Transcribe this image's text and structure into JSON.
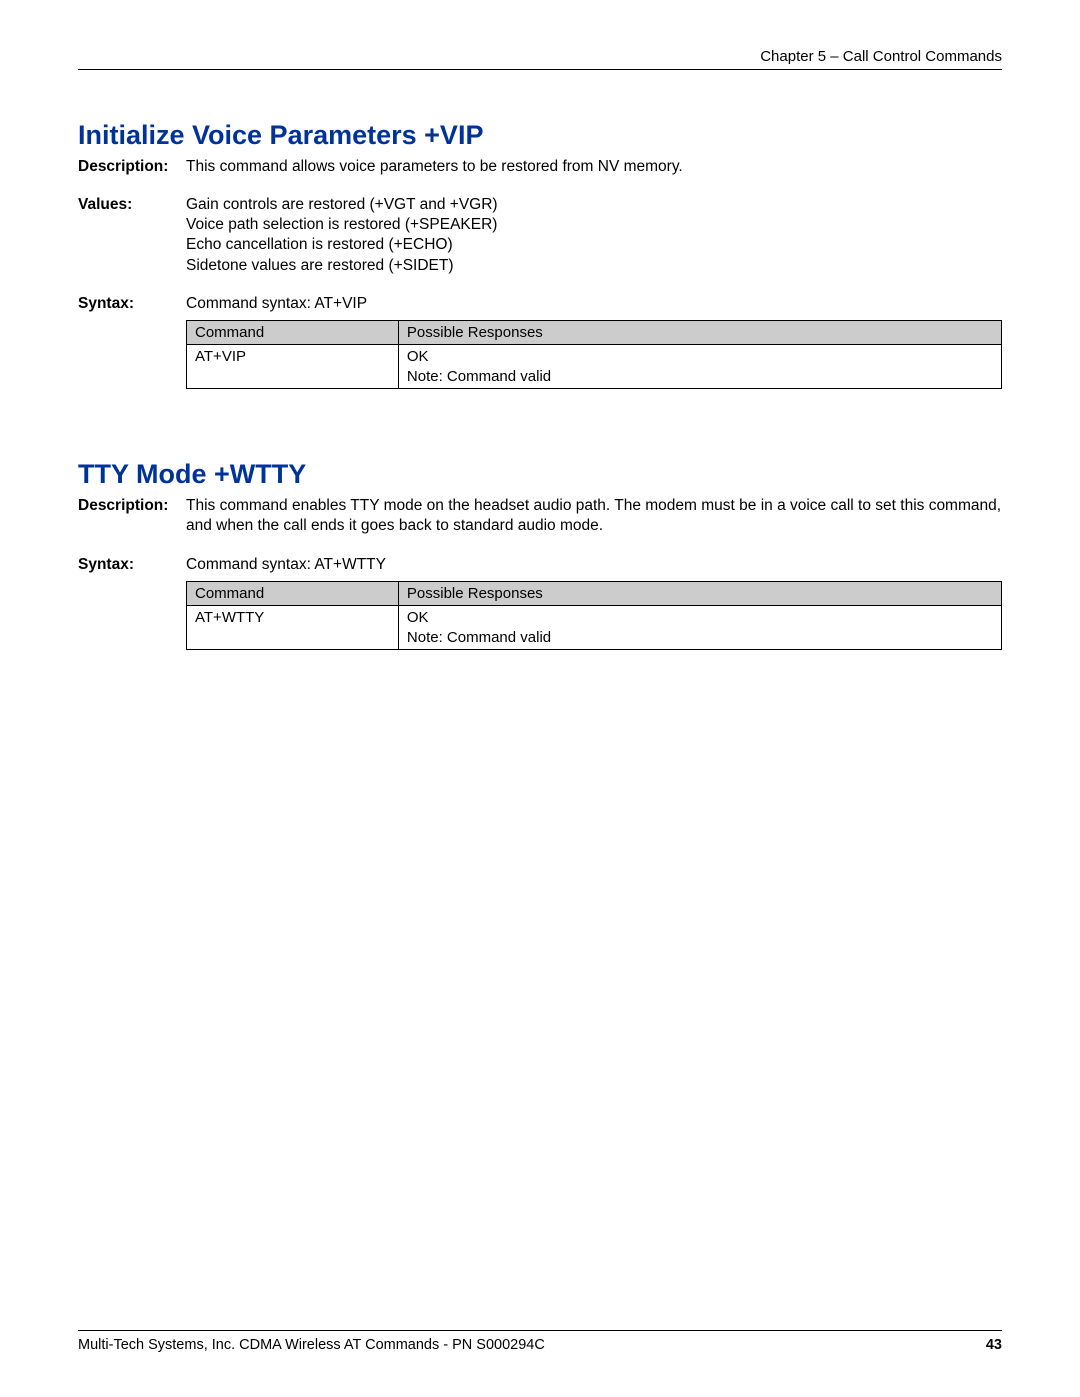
{
  "header": {
    "chapter": "Chapter 5 – Call Control Commands"
  },
  "sections": {
    "vip": {
      "title": "Initialize Voice Parameters  +VIP",
      "descLabel": "Description:",
      "desc": "This command allows voice parameters to be restored from NV memory.",
      "valuesLabel": "Values:",
      "valuesLines": [
        "Gain controls are restored (+VGT and +VGR)",
        "Voice path selection is restored (+SPEAKER)",
        "Echo cancellation is restored (+ECHO)",
        "Sidetone values are restored (+SIDET)"
      ],
      "syntaxLabel": "Syntax:",
      "syntaxText": "Command syntax: AT+VIP",
      "table": {
        "h1": "Command",
        "h2": "Possible Responses",
        "c1": "AT+VIP",
        "c2a": "OK",
        "c2b": "Note: Command valid"
      }
    },
    "wtty": {
      "title": "TTY Mode  +WTTY",
      "descLabel": "Description:",
      "desc": "This command enables TTY mode on the headset audio path. The modem must be in a voice call to set this command, and when the call ends it goes back to standard audio mode.",
      "syntaxLabel": "Syntax:",
      "syntaxText": "Command syntax: AT+WTTY",
      "table": {
        "h1": "Command",
        "h2": "Possible Responses",
        "c1": "AT+WTTY",
        "c2a": "OK",
        "c2b": "Note: Command valid"
      }
    }
  },
  "footer": {
    "text": "Multi-Tech Systems, Inc. CDMA Wireless AT Commands - PN S000294C",
    "page": "43"
  }
}
